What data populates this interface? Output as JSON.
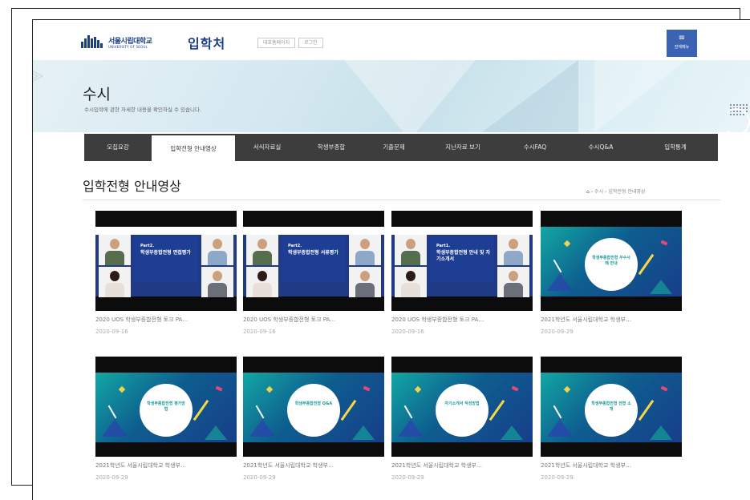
{
  "header": {
    "logo_text": "서울시립대학교",
    "logo_sub": "UNIVERSITY OF SEOUL",
    "site_title": "입학처",
    "util_links": [
      "대표홈페이지",
      "로그인"
    ],
    "menu_label": "전체메뉴"
  },
  "banner": {
    "title": "수시",
    "description": "수시입학에 관한 자세한 내용을 확인하실 수 있습니다."
  },
  "nav": {
    "items": [
      "모집요강",
      "입학전형 안내영상",
      "서식자료실",
      "학생부종합",
      "기출문제",
      "지난자료 보기",
      "수시FAQ",
      "수시Q&A",
      "입학통계"
    ],
    "active_index": 1
  },
  "section": {
    "title": "입학전형 안내영상",
    "breadcrumb": [
      "수시",
      "입학전형 안내영상"
    ]
  },
  "videos": [
    {
      "title": "2020 UOS 학생부종합전형 토크 PA…",
      "date": "2020-09-16",
      "thumb": "part",
      "part": "Part2.",
      "thumb_text": "학생부종합전형 면접평가"
    },
    {
      "title": "2020 UOS 학생부종합전형 토크 PA…",
      "date": "2020-09-16",
      "thumb": "part",
      "part": "Part2.",
      "thumb_text": "학생부종합전형 서류평가"
    },
    {
      "title": "2020 UOS 학생부종합전형 토크 PA…",
      "date": "2020-09-16",
      "thumb": "part",
      "part": "Part1.",
      "thumb_text": "학생부종합전형 안내 및 자기소개서"
    },
    {
      "title": "2021학년도 서울시립대학교 학생부…",
      "date": "2020-09-29",
      "thumb": "teal",
      "thumb_text": "학생부종합전형 우수사례 안내"
    },
    {
      "title": "2021학년도 서울시립대학교 학생부…",
      "date": "2020-09-29",
      "thumb": "teal",
      "thumb_text": "학생부종합전형 평가방법"
    },
    {
      "title": "2021학년도 서울시립대학교 학생부…",
      "date": "2020-09-29",
      "thumb": "teal",
      "thumb_text": "학생부종합전형 Q&A"
    },
    {
      "title": "2021학년도 서울시립대학교 학생부…",
      "date": "2020-09-29",
      "thumb": "teal",
      "thumb_text": "자기소개서 작성방법"
    },
    {
      "title": "2021학년도 서울시립대학교 학생부…",
      "date": "2020-09-29",
      "thumb": "teal",
      "thumb_text": "학생부종합전형 전형 소개"
    }
  ],
  "colors": {
    "brand": "#1c3f86",
    "menu_button": "#3b63b3",
    "nav_bg": "#3d3d3d"
  }
}
